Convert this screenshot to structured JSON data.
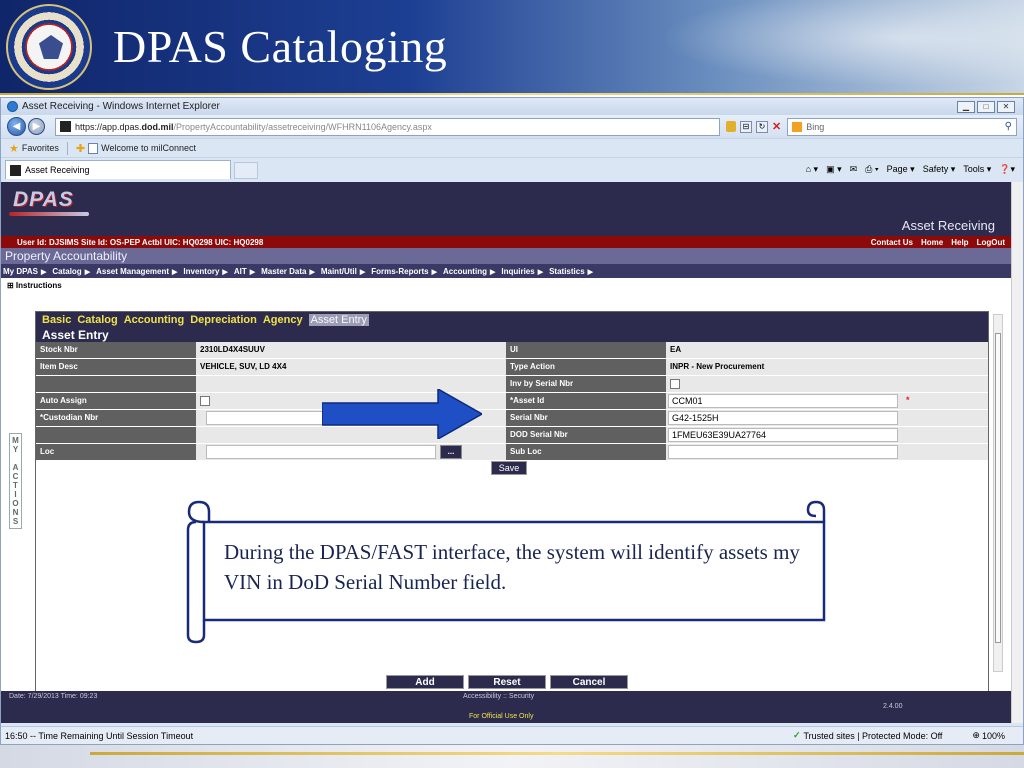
{
  "slide": {
    "title": "DPAS Cataloging"
  },
  "browser": {
    "title": "Asset Receiving - Windows Internet Explorer",
    "url_prefix": "https://app.dpas.",
    "url_host": "dod.mil",
    "url_path": "/PropertyAccountability/assetreceiving/WFHRN1106Agency.aspx",
    "search_placeholder": "Bing",
    "favorites_label": "Favorites",
    "favorite_link": "Welcome to milConnect",
    "tab_label": "Asset Receiving",
    "commands": [
      "Page ▾",
      "Safety ▾",
      "Tools ▾"
    ],
    "status_left": "16:50  -- Time Remaining Until Session Timeout",
    "status_zone": "Trusted sites | Protected Mode: Off",
    "zoom": "100%"
  },
  "app": {
    "logo": "DPAS",
    "page_title": "Asset Receiving",
    "userbar": "User Id: DJSIMS   Site Id: OS-PEP   Actbl UIC: HQ0298   UIC: HQ0298",
    "userbar_links": [
      "Contact Us",
      "Home",
      "Help",
      "LogOut"
    ],
    "module": "Property Accountability",
    "menu": [
      "My DPAS",
      "Catalog",
      "Asset Management",
      "Inventory",
      "AIT",
      "Master Data",
      "Maint/Util",
      "Forms-Reports",
      "Accounting",
      "Inquiries",
      "Statistics"
    ],
    "instructions": "⊞ Instructions",
    "my_actions": "M Y   A C T I O N S"
  },
  "form": {
    "subtabs": [
      "Basic",
      "Catalog",
      "Accounting",
      "Depreciation",
      "Agency"
    ],
    "active_subtab": "Asset Entry",
    "title": "Asset Entry",
    "left": {
      "stock_nbr_label": "Stock Nbr",
      "stock_nbr": "2310LD4X4SUUV",
      "item_desc_label": "Item Desc",
      "item_desc": "VEHICLE, SUV, LD 4X4",
      "auto_assign_label": "Auto Assign",
      "custodian_label": "*Custodian Nbr",
      "loc_label": "Loc"
    },
    "right": {
      "ui_label": "UI",
      "ui": "EA",
      "type_action_label": "Type Action",
      "type_action": "INPR - New Procurement",
      "inv_serial_label": "Inv by Serial Nbr",
      "asset_id_label": "*Asset Id",
      "asset_id": "CCM01",
      "serial_label": "Serial Nbr",
      "serial": "G42-1525H",
      "dod_serial_label": "DOD Serial Nbr",
      "dod_serial": "1FMEU63E39UA27764",
      "sub_loc_label": "Sub Loc"
    },
    "save": "Save",
    "ellipsis": "...",
    "required_mark": "*",
    "actions": [
      "Add",
      "Reset",
      "Cancel"
    ]
  },
  "footer": {
    "datetime": "Date: 7/29/2013 Time: 09:23",
    "accessibility": "Accessibility :: Security",
    "version": "2.4.00",
    "fouo": "For Official Use Only"
  },
  "callout": {
    "text": "During the DPAS/FAST interface, the system will identify assets my VIN in DoD Serial Number field."
  },
  "colors": {
    "accent": "#2c2b4e",
    "userbar": "#8c0a0a",
    "arrow": "#1f4fc4"
  }
}
